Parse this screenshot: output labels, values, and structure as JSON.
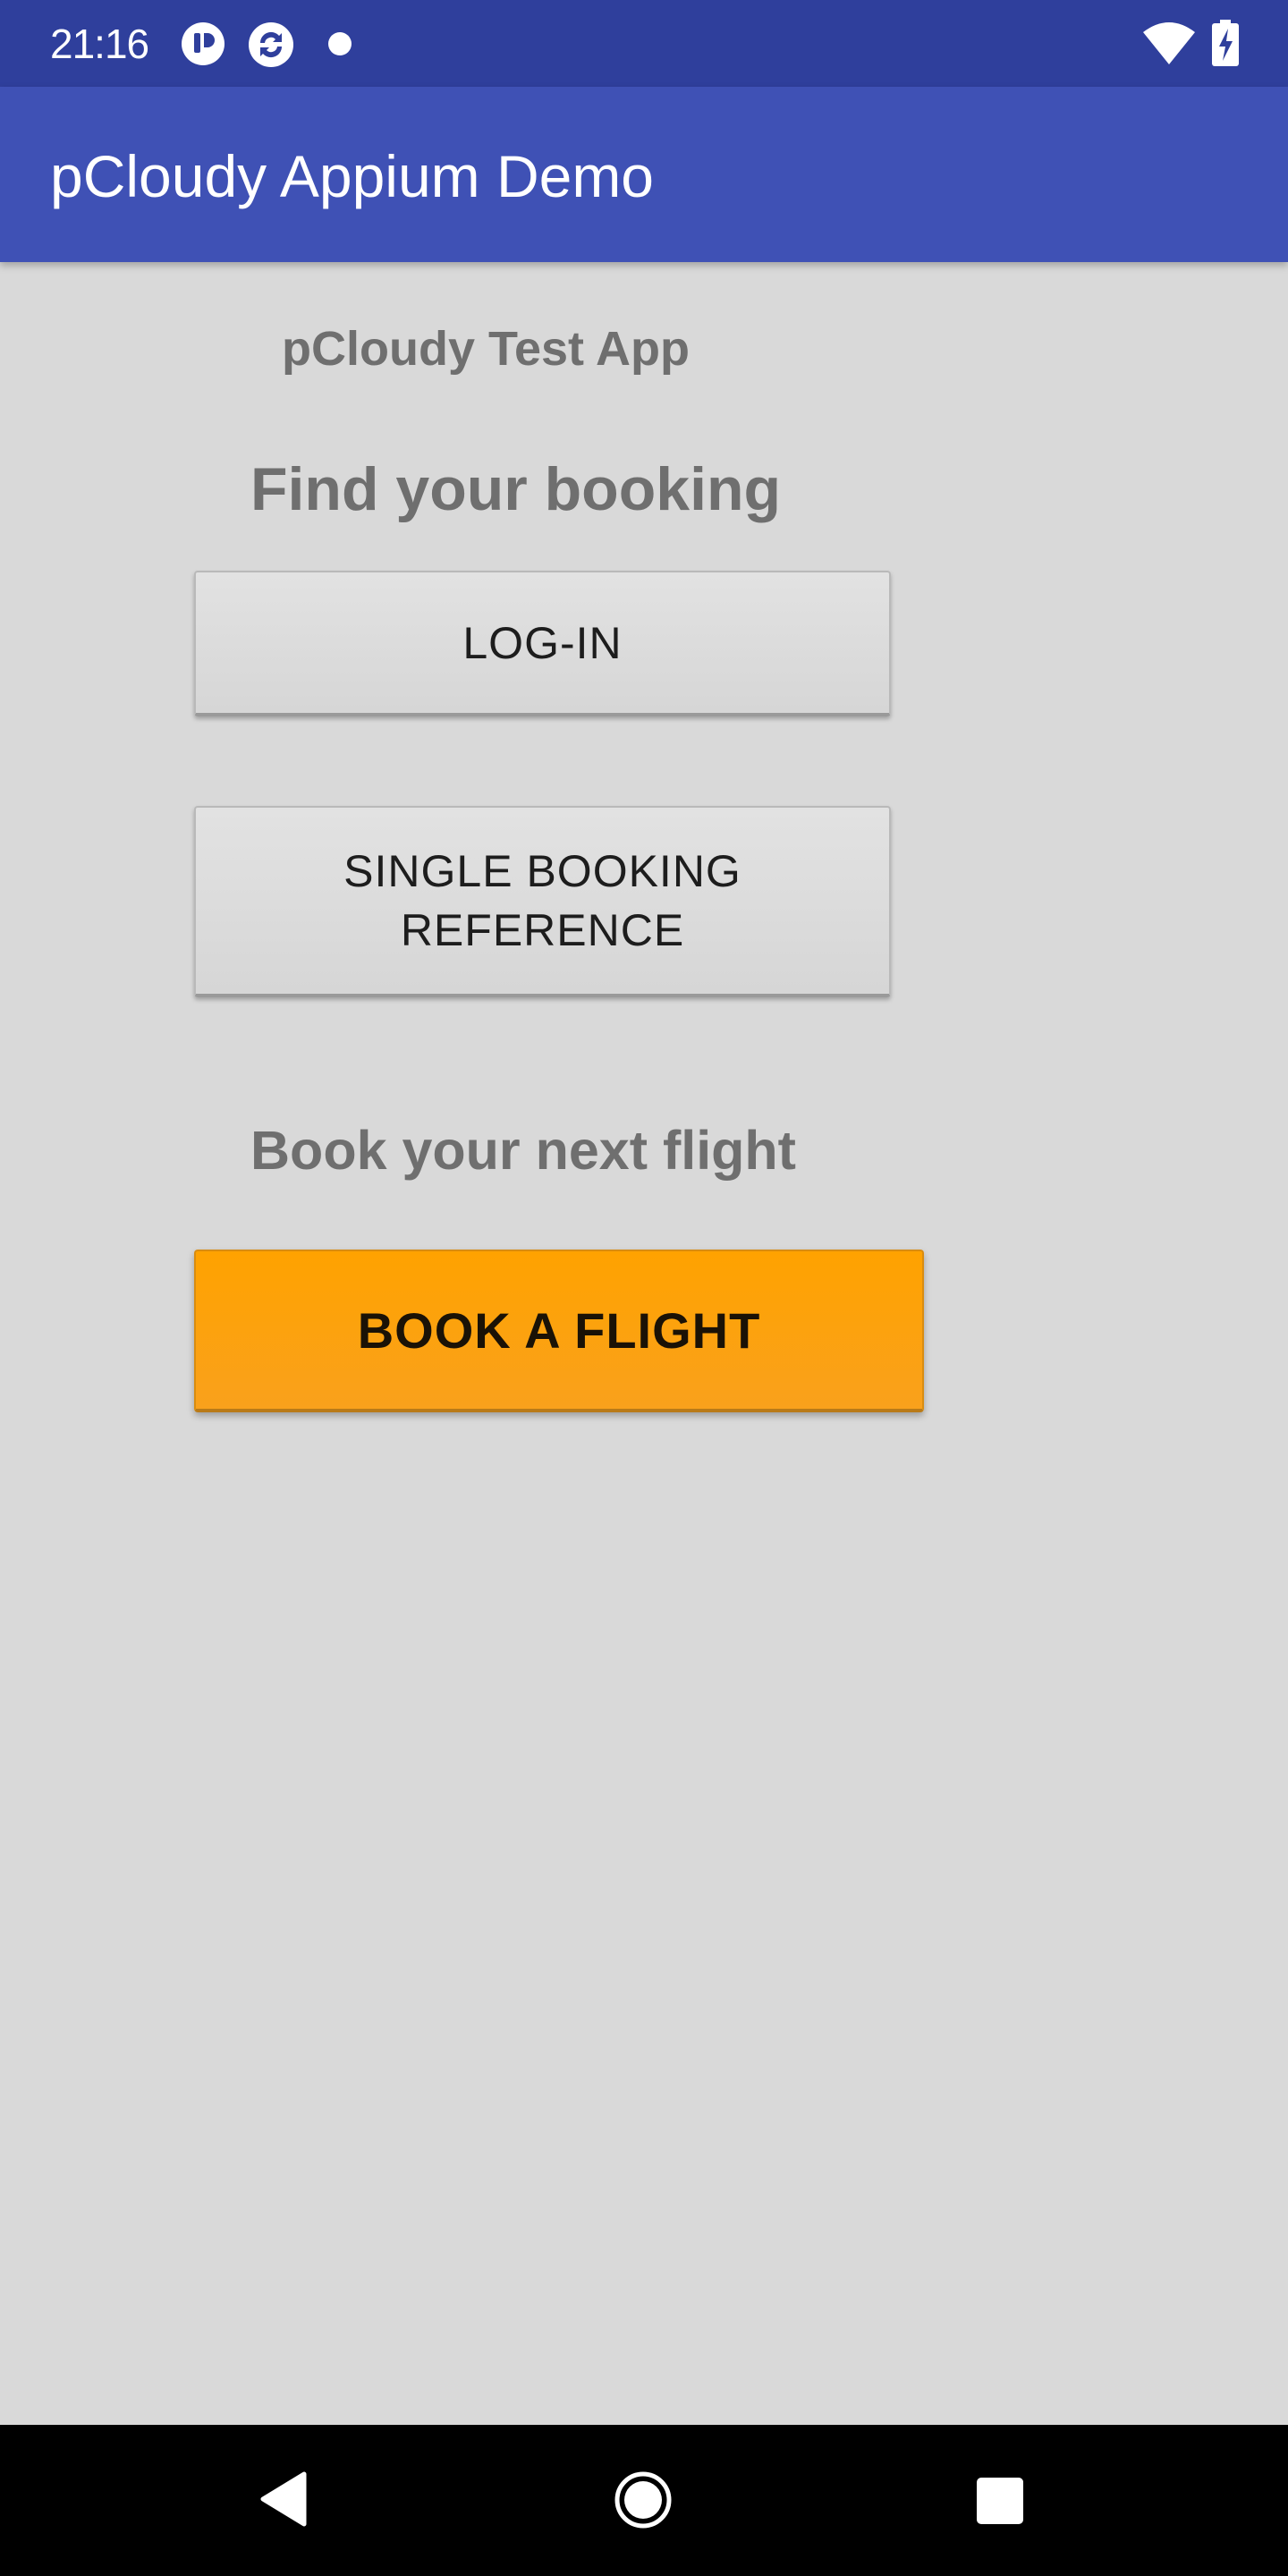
{
  "status_bar": {
    "time": "21:16",
    "icons": [
      "notification-app-icon",
      "notification-sync-icon",
      "notification-dot-icon",
      "wifi-icon",
      "battery-charging-icon"
    ]
  },
  "app_bar": {
    "title": "pCloudy Appium Demo",
    "color": "#3f51b5"
  },
  "content": {
    "subtitle": "pCloudy Test App",
    "find_heading": "Find your booking",
    "login_button": "LOG-IN",
    "single_booking_button": "SINGLE BOOKING REFERENCE",
    "book_heading": "Book your next flight",
    "book_flight_button": "BOOK A FLIGHT",
    "accent_color": "#ffa200"
  },
  "nav_bar": {
    "buttons": [
      "back-icon",
      "home-icon",
      "recents-icon"
    ]
  }
}
